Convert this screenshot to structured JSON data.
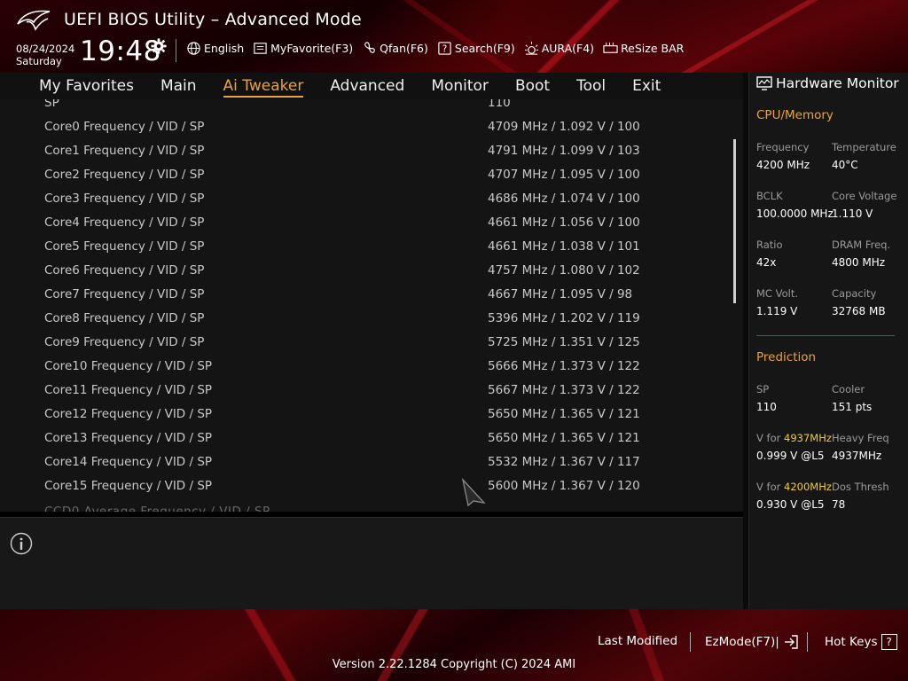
{
  "header": {
    "title": "UEFI BIOS Utility – Advanced Mode",
    "date": "08/24/2024",
    "day": "Saturday",
    "time": "19:48",
    "toolbar": [
      {
        "label": "English",
        "icon": "globe-icon"
      },
      {
        "label": "MyFavorite(F3)",
        "icon": "favorite-icon"
      },
      {
        "label": "Qfan(F6)",
        "icon": "fan-icon"
      },
      {
        "label": "Search(F9)",
        "icon": "search-icon"
      },
      {
        "label": "AURA(F4)",
        "icon": "aura-icon"
      },
      {
        "label": "ReSize BAR",
        "icon": "resize-bar-icon"
      }
    ]
  },
  "menu": {
    "tabs": [
      "My Favorites",
      "Main",
      "Ai Tweaker",
      "Advanced",
      "Monitor",
      "Boot",
      "Tool",
      "Exit"
    ],
    "active": "Ai Tweaker"
  },
  "content": {
    "partial_top": {
      "label": "SP",
      "value": "110"
    },
    "rows": [
      {
        "label": "Core0 Frequency / VID / SP",
        "value": "4709 MHz / 1.092 V / 100"
      },
      {
        "label": "Core1 Frequency / VID / SP",
        "value": "4791 MHz / 1.099 V / 103"
      },
      {
        "label": "Core2 Frequency / VID / SP",
        "value": "4707 MHz / 1.095 V / 100"
      },
      {
        "label": "Core3 Frequency / VID / SP",
        "value": "4686 MHz / 1.074 V / 100"
      },
      {
        "label": "Core4 Frequency / VID / SP",
        "value": "4661 MHz / 1.056 V / 100"
      },
      {
        "label": "Core5 Frequency / VID / SP",
        "value": "4661 MHz / 1.038 V / 101"
      },
      {
        "label": "Core6 Frequency / VID / SP",
        "value": "4757 MHz / 1.080 V / 102"
      },
      {
        "label": "Core7 Frequency / VID / SP",
        "value": "4667 MHz / 1.095 V / 98"
      },
      {
        "label": "Core8 Frequency / VID / SP",
        "value": "5396 MHz / 1.202 V / 119"
      },
      {
        "label": "Core9 Frequency / VID / SP",
        "value": "5725 MHz / 1.351 V / 125"
      },
      {
        "label": "Core10 Frequency / VID / SP",
        "value": "5666 MHz / 1.373 V / 122"
      },
      {
        "label": "Core11 Frequency / VID / SP",
        "value": "5667 MHz / 1.373 V / 122"
      },
      {
        "label": "Core12 Frequency / VID / SP",
        "value": "5650 MHz / 1.365 V / 121"
      },
      {
        "label": "Core13 Frequency / VID / SP",
        "value": "5650 MHz / 1.365 V / 121"
      },
      {
        "label": "Core14 Frequency / VID / SP",
        "value": "5532 MHz / 1.367 V / 117"
      },
      {
        "label": "Core15 Frequency / VID / SP",
        "value": "5600 MHz / 1.367 V / 120"
      }
    ]
  },
  "hardware_monitor": {
    "title": "Hardware Monitor",
    "cpu_memory": {
      "heading": "CPU/Memory",
      "frequency_label": "Frequency",
      "frequency": "4200 MHz",
      "temperature_label": "Temperature",
      "temperature": "40°C",
      "bclk_label": "BCLK",
      "bclk": "100.0000 MHz",
      "core_voltage_label": "Core Voltage",
      "core_voltage": "1.110 V",
      "ratio_label": "Ratio",
      "ratio": "42x",
      "dram_freq_label": "DRAM Freq.",
      "dram_freq": "4800 MHz",
      "mc_volt_label": "MC Volt.",
      "mc_volt": "1.119 V",
      "capacity_label": "Capacity",
      "capacity": "32768 MB"
    },
    "prediction": {
      "heading": "Prediction",
      "sp_label": "SP",
      "sp": "110",
      "cooler_label": "Cooler",
      "cooler": "151 pts",
      "vfor1_prefix": "V for ",
      "vfor1_freq": "4937MHz",
      "vfor1": "0.999 V @L5",
      "heavy_freq_label": "Heavy Freq",
      "heavy_freq": "4937MHz",
      "vfor2_prefix": "V for ",
      "vfor2_freq": "4200MHz",
      "vfor2": "0.930 V @L5",
      "dos_thresh_label": "Dos Thresh",
      "dos_thresh": "78"
    }
  },
  "footer": {
    "last_modified": "Last Modified",
    "ezmode": "EzMode(F7)|",
    "hot_keys": "Hot Keys",
    "hot_keys_key": "?",
    "version": "Version 2.22.1284 Copyright (C) 2024 AMI"
  },
  "colors": {
    "accent": "#e8a33c",
    "highlight": "#f0cc3a",
    "brand_red": "#8a0a10"
  }
}
